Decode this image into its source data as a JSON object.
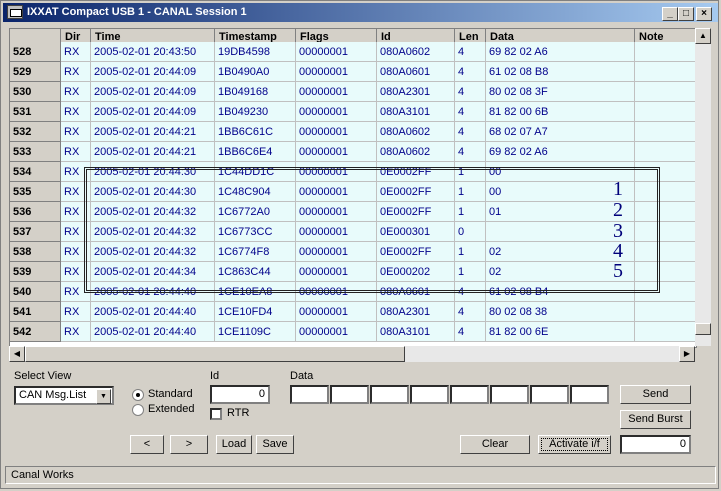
{
  "window": {
    "title": "IXXAT Compact USB 1 - CANAL Session 1",
    "minimize": "_",
    "maximize": "□",
    "close": "×"
  },
  "table": {
    "columns": [
      "Dir",
      "Time",
      "Timestamp",
      "Flags",
      "Id",
      "Len",
      "Data",
      "Note"
    ],
    "rows": [
      {
        "num": "528",
        "dir": "RX",
        "time": "2005-02-01 20:43:50",
        "ts": "19DB4598",
        "flags": "00000001",
        "id": "080A0602",
        "len": "4",
        "data": "69 82 02 A6"
      },
      {
        "num": "529",
        "dir": "RX",
        "time": "2005-02-01 20:44:09",
        "ts": "1B0490A0",
        "flags": "00000001",
        "id": "080A0601",
        "len": "4",
        "data": "61 02 08 B8"
      },
      {
        "num": "530",
        "dir": "RX",
        "time": "2005-02-01 20:44:09",
        "ts": "1B049168",
        "flags": "00000001",
        "id": "080A2301",
        "len": "4",
        "data": "80 02 08 3F"
      },
      {
        "num": "531",
        "dir": "RX",
        "time": "2005-02-01 20:44:09",
        "ts": "1B049230",
        "flags": "00000001",
        "id": "080A3101",
        "len": "4",
        "data": "81 82 00 6B"
      },
      {
        "num": "532",
        "dir": "RX",
        "time": "2005-02-01 20:44:21",
        "ts": "1BB6C61C",
        "flags": "00000001",
        "id": "080A0602",
        "len": "4",
        "data": "68 02 07 A7"
      },
      {
        "num": "533",
        "dir": "RX",
        "time": "2005-02-01 20:44:21",
        "ts": "1BB6C6E4",
        "flags": "00000001",
        "id": "080A0602",
        "len": "4",
        "data": "69 82 02 A6"
      },
      {
        "num": "534",
        "dir": "RX",
        "time": "2005-02-01 20:44:30",
        "ts": "1C44DD1C",
        "flags": "00000001",
        "id": "0E0002FF",
        "len": "1",
        "data": "00"
      },
      {
        "num": "535",
        "dir": "RX",
        "time": "2005-02-01 20:44:30",
        "ts": "1C48C904",
        "flags": "00000001",
        "id": "0E0002FF",
        "len": "1",
        "data": "00"
      },
      {
        "num": "536",
        "dir": "RX",
        "time": "2005-02-01 20:44:32",
        "ts": "1C6772A0",
        "flags": "00000001",
        "id": "0E0002FF",
        "len": "1",
        "data": "01"
      },
      {
        "num": "537",
        "dir": "RX",
        "time": "2005-02-01 20:44:32",
        "ts": "1C6773CC",
        "flags": "00000001",
        "id": "0E000301",
        "len": "0",
        "data": ""
      },
      {
        "num": "538",
        "dir": "RX",
        "time": "2005-02-01 20:44:32",
        "ts": "1C6774F8",
        "flags": "00000001",
        "id": "0E0002FF",
        "len": "1",
        "data": "02"
      },
      {
        "num": "539",
        "dir": "RX",
        "time": "2005-02-01 20:44:34",
        "ts": "1C863C44",
        "flags": "00000001",
        "id": "0E000202",
        "len": "1",
        "data": "02"
      },
      {
        "num": "540",
        "dir": "RX",
        "time": "2005-02-01 20:44:40",
        "ts": "1CE10EA8",
        "flags": "00000001",
        "id": "080A0601",
        "len": "4",
        "data": "61 02 08 B4"
      },
      {
        "num": "541",
        "dir": "RX",
        "time": "2005-02-01 20:44:40",
        "ts": "1CE10FD4",
        "flags": "00000001",
        "id": "080A2301",
        "len": "4",
        "data": "80 02 08 38"
      },
      {
        "num": "542",
        "dir": "RX",
        "time": "2005-02-01 20:44:40",
        "ts": "1CE1109C",
        "flags": "00000001",
        "id": "080A3101",
        "len": "4",
        "data": "81 82 00 6E"
      }
    ],
    "annotations": [
      "1",
      "2",
      "3",
      "4",
      "5"
    ]
  },
  "controls": {
    "select_view_label": "Select View",
    "select_view_value": "CAN Msg.List",
    "standard_label": "Standard",
    "extended_label": "Extended",
    "id_label": "Id",
    "id_value": "0",
    "rtr_label": "RTR",
    "data_label": "Data",
    "prev_label": "<",
    "next_label": ">",
    "load_label": "Load",
    "save_label": "Save",
    "clear_label": "Clear",
    "activate_label": "Activate i/f",
    "send_label": "Send",
    "send_burst_label": "Send Burst",
    "burst_value": "0"
  },
  "status": {
    "text": "Canal Works"
  }
}
